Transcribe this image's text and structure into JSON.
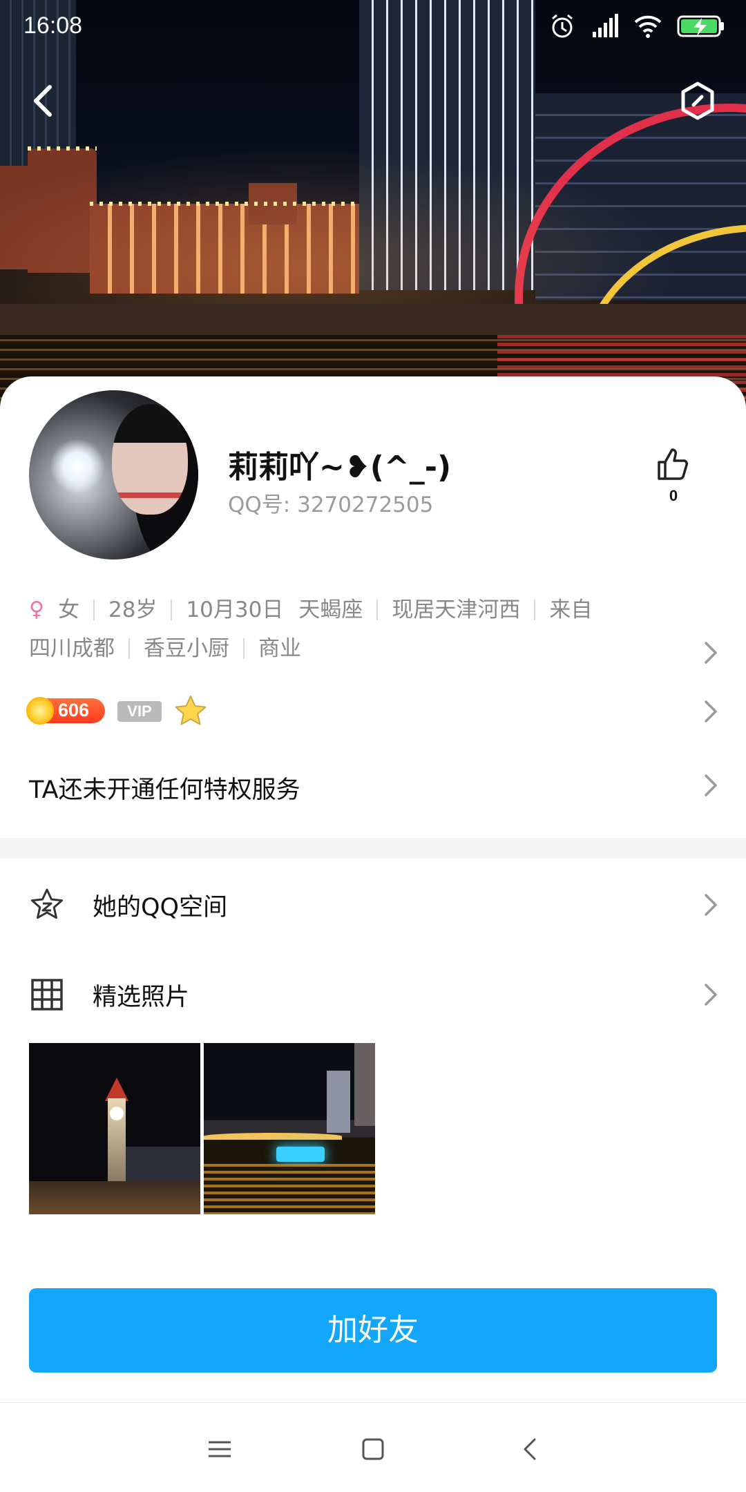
{
  "status_bar": {
    "time": "16:08",
    "icons": [
      "alarm-icon",
      "signal-icon",
      "wifi-icon",
      "battery-charging-icon"
    ]
  },
  "header": {
    "back_icon": "back-arrow-icon",
    "settings_icon": "hexagon-settings-icon"
  },
  "profile": {
    "nickname": "莉莉吖~❥(^_-)",
    "qq_number": "QQ号: 3270272505",
    "likes": "0",
    "gender": "女",
    "age": "28岁",
    "birthday": "10月30日",
    "zodiac": "天蝎座",
    "residence": "现居天津河西",
    "from_prefix": "来自",
    "hometown": "四川成都",
    "company": "香豆小厨",
    "industry": "商业"
  },
  "badges": {
    "level": "606",
    "vip": "VIP"
  },
  "privilege_text": "TA还未开通任何特权服务",
  "menu": {
    "qzone": "她的QQ空间",
    "photos": "精选照片"
  },
  "photos": [
    "clock-tower-night-photo",
    "river-night-photo"
  ],
  "action": {
    "add_friend": "加好友"
  },
  "colors": {
    "primary": "#12A7FA",
    "female": "#F36EA1",
    "level": "#FF4A26"
  }
}
